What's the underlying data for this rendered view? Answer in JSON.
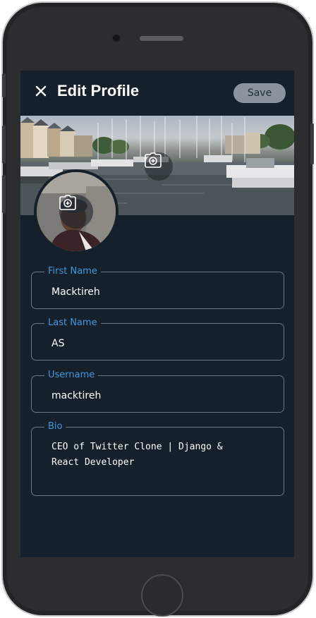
{
  "header": {
    "close_icon": "close-icon",
    "title": "Edit Profile",
    "save_label": "Save"
  },
  "banner": {
    "camera_icon": "camera-add-icon"
  },
  "avatar": {
    "camera_icon": "camera-add-icon"
  },
  "form": {
    "fields": [
      {
        "label": "First Name",
        "value": "Macktireh"
      },
      {
        "label": "Last Name",
        "value": "AS"
      },
      {
        "label": "Username",
        "value": "macktireh"
      },
      {
        "label": "Bio",
        "value": "CEO of Twitter Clone | Django &\nReact Developer"
      }
    ]
  },
  "colors": {
    "background": "#16202a",
    "accent": "#3f98e0",
    "save_button": "#8b949c",
    "border": "#6c7782"
  }
}
